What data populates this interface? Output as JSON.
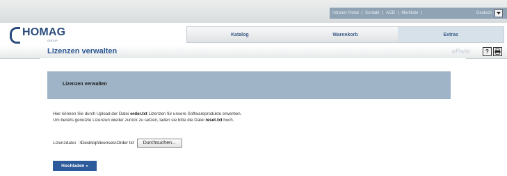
{
  "header": {
    "util_links": [
      "Intranet Portal",
      "Kontakt",
      "AGB",
      "Merkliste",
      "Deutsch"
    ],
    "logo": {
      "brand": "HOMAG",
      "subtitle": "GROUP"
    }
  },
  "nav": {
    "tabs": [
      {
        "label": "Katalog",
        "active": false
      },
      {
        "label": "Warenkorb",
        "active": false
      },
      {
        "label": "Extras",
        "active": true
      }
    ]
  },
  "page": {
    "title": "Lizenzen verwalten",
    "eparts": "eParts",
    "help_icon": "?",
    "print_icon": "print-icon"
  },
  "panel": {
    "heading": "Lizenzen verwalten"
  },
  "description": {
    "line1_pre": "Hier können Sie durch Upload der Datei ",
    "line1_file": "order.txt",
    "line1_post": " Lizenzen für unsere Softwareprodukte erwerben.",
    "line2_pre": "Um bereits genutzte Lizenzen wieder zurück zu setzen, laden sie bitte die Datei ",
    "line2_file": "reset.txt",
    "line2_post": " hoch."
  },
  "upload": {
    "label": "Lizenzdatei",
    "file_value": ":\\Desktop\\licenses\\Order txt",
    "browse_label": "Durchsuchen...",
    "submit_label": "Hochladen »"
  },
  "colors": {
    "accent": "#2d5a9a",
    "panel": "#9fb4c7",
    "title": "#2c5891"
  }
}
